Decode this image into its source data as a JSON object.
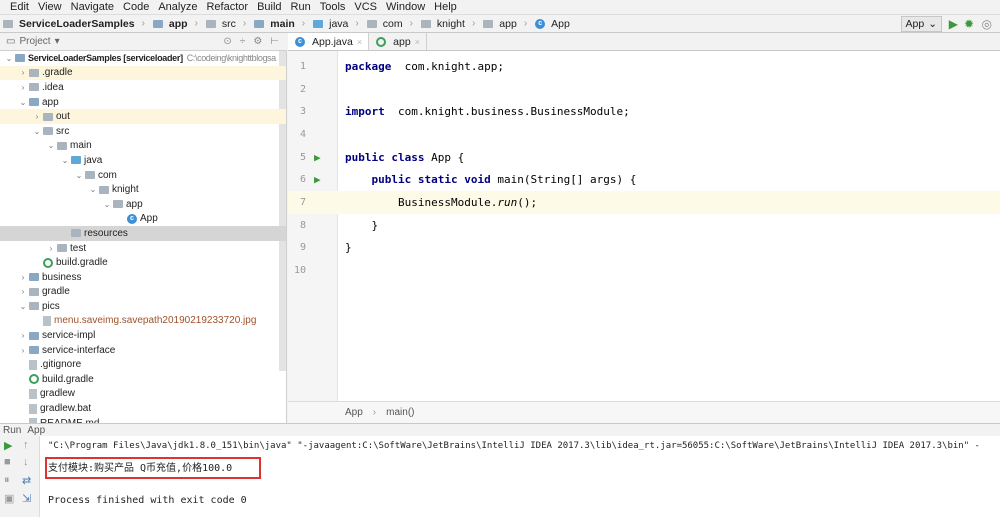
{
  "menu": [
    "Edit",
    "View",
    "Navigate",
    "Code",
    "Analyze",
    "Refactor",
    "Build",
    "Run",
    "Tools",
    "VCS",
    "Window",
    "Help"
  ],
  "breadcrumb": [
    {
      "label": "ServiceLoaderSamples",
      "bold": true,
      "icon": "folder"
    },
    {
      "label": "app",
      "bold": true,
      "icon": "module-folder"
    },
    {
      "label": "src",
      "bold": false,
      "icon": "folder"
    },
    {
      "label": "main",
      "bold": true,
      "icon": "module-folder"
    },
    {
      "label": "java",
      "bold": false,
      "icon": "source-folder"
    },
    {
      "label": "com",
      "bold": false,
      "icon": "folder"
    },
    {
      "label": "knight",
      "bold": false,
      "icon": "folder"
    },
    {
      "label": "app",
      "bold": false,
      "icon": "folder"
    },
    {
      "label": "App",
      "bold": false,
      "icon": "class"
    }
  ],
  "run_config": "App",
  "project_panel": {
    "title": "Project"
  },
  "tree": [
    {
      "d": 0,
      "a": "v",
      "icon": "module-folder",
      "label": "ServiceLoaderSamples [serviceloader]",
      "extra": "C:\\codeing\\knighttblogsa",
      "bold": true
    },
    {
      "d": 1,
      "a": ">",
      "icon": "folder",
      "label": ".gradle",
      "hl": true
    },
    {
      "d": 1,
      "a": ">",
      "icon": "folder",
      "label": ".idea"
    },
    {
      "d": 1,
      "a": "v",
      "icon": "module-folder",
      "label": "app"
    },
    {
      "d": 2,
      "a": ">",
      "icon": "folder",
      "label": "out",
      "hl": true
    },
    {
      "d": 2,
      "a": "v",
      "icon": "folder",
      "label": "src"
    },
    {
      "d": 3,
      "a": "v",
      "icon": "folder",
      "label": "main"
    },
    {
      "d": 4,
      "a": "v",
      "icon": "source-folder",
      "label": "java"
    },
    {
      "d": 5,
      "a": "v",
      "icon": "folder",
      "label": "com"
    },
    {
      "d": 6,
      "a": "v",
      "icon": "folder",
      "label": "knight"
    },
    {
      "d": 7,
      "a": "v",
      "icon": "folder",
      "label": "app"
    },
    {
      "d": 8,
      "a": "",
      "icon": "class",
      "label": "App"
    },
    {
      "d": 4,
      "a": "",
      "icon": "folder",
      "label": "resources",
      "sel": true
    },
    {
      "d": 3,
      "a": ">",
      "icon": "folder",
      "label": "test"
    },
    {
      "d": 2,
      "a": "",
      "icon": "gradle",
      "label": "build.gradle"
    },
    {
      "d": 1,
      "a": ">",
      "icon": "module-folder",
      "label": "business"
    },
    {
      "d": 1,
      "a": ">",
      "icon": "folder",
      "label": "gradle"
    },
    {
      "d": 1,
      "a": "v",
      "icon": "folder",
      "label": "pics"
    },
    {
      "d": 2,
      "a": "",
      "icon": "file",
      "label": "menu.saveimg.savepath20190219233720.jpg",
      "img": true
    },
    {
      "d": 1,
      "a": ">",
      "icon": "module-folder",
      "label": "service-impl"
    },
    {
      "d": 1,
      "a": ">",
      "icon": "module-folder",
      "label": "service-interface"
    },
    {
      "d": 1,
      "a": "",
      "icon": "file",
      "label": ".gitignore"
    },
    {
      "d": 1,
      "a": "",
      "icon": "gradle",
      "label": "build.gradle"
    },
    {
      "d": 1,
      "a": "",
      "icon": "file",
      "label": "gradlew"
    },
    {
      "d": 1,
      "a": "",
      "icon": "file",
      "label": "gradlew.bat"
    },
    {
      "d": 1,
      "a": "",
      "icon": "file",
      "label": "README.md"
    }
  ],
  "tabs": [
    {
      "label": "App.java",
      "icon": "class",
      "active": true
    },
    {
      "label": "app",
      "icon": "gradle",
      "active": false
    }
  ],
  "code": [
    {
      "n": "1",
      "parts": [
        [
          "kw",
          "package"
        ],
        [
          "",
          "  com.knight.app;"
        ]
      ]
    },
    {
      "n": "2",
      "parts": []
    },
    {
      "n": "3",
      "parts": [
        [
          "kw",
          "import"
        ],
        [
          "",
          "  com.knight.business.BusinessModule;"
        ]
      ]
    },
    {
      "n": "4",
      "parts": []
    },
    {
      "n": "5",
      "run": true,
      "parts": [
        [
          "kw",
          "public class"
        ],
        [
          "",
          " App {"
        ]
      ]
    },
    {
      "n": "6",
      "run": true,
      "parts": [
        [
          "",
          "    "
        ],
        [
          "kw",
          "public static void"
        ],
        [
          "",
          " main(String[] args) {"
        ]
      ]
    },
    {
      "n": "7",
      "cur": true,
      "parts": [
        [
          "",
          "        BusinessModule."
        ],
        [
          "it",
          "run"
        ],
        [
          "",
          "();"
        ]
      ]
    },
    {
      "n": "8",
      "parts": [
        [
          "",
          "    }"
        ]
      ]
    },
    {
      "n": "9",
      "parts": [
        [
          "",
          "}"
        ]
      ]
    },
    {
      "n": "10",
      "parts": []
    }
  ],
  "editor_breadcrumb": [
    "App",
    "main()"
  ],
  "run_panel": {
    "label": "Run",
    "config": "App"
  },
  "console": [
    "\"C:\\Program Files\\Java\\jdk1.8.0_151\\bin\\java\" \"-javaagent:C:\\SoftWare\\JetBrains\\IntelliJ IDEA 2017.3\\lib\\idea_rt.jar=56055:C:\\SoftWare\\JetBrains\\IntelliJ IDEA 2017.3\\bin\" -",
    "支付模块:购买产品 Q币充值,价格100.0",
    "",
    "Process finished with exit code 0"
  ]
}
